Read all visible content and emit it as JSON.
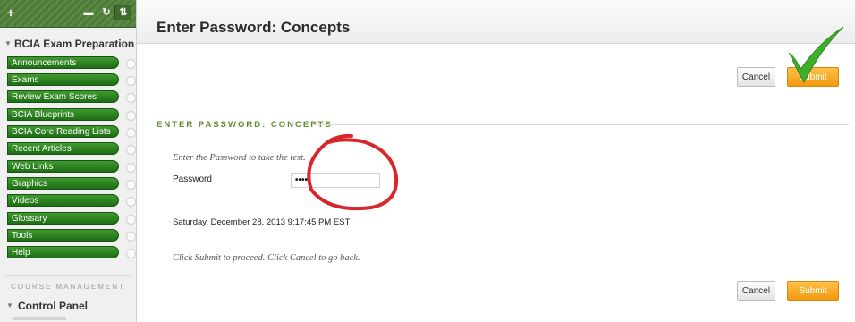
{
  "sidebar": {
    "toolbar": {
      "add_icon": "plus-icon",
      "icons": [
        "folder-icon",
        "refresh-icon",
        "sort-icon"
      ]
    },
    "course_title": "BCIA Exam Preparation",
    "menu_items": [
      {
        "label": "Announcements"
      },
      {
        "label": "Exams"
      },
      {
        "label": "Review Exam Scores"
      },
      {
        "label": "BCIA Blueprints"
      },
      {
        "label": "BCIA Core Reading Lists"
      },
      {
        "label": "Recent Articles"
      },
      {
        "label": "Web Links"
      },
      {
        "label": "Graphics"
      },
      {
        "label": "Videos"
      },
      {
        "label": "Glossary"
      },
      {
        "label": "Tools"
      },
      {
        "label": "Help"
      }
    ],
    "course_management_heading": "COURSE MANAGEMENT",
    "control_panel": "Control Panel"
  },
  "header": {
    "title": "Enter Password: Concepts"
  },
  "buttons": {
    "cancel": "Cancel",
    "submit": "Submit"
  },
  "form": {
    "section_heading": "ENTER PASSWORD: CONCEPTS",
    "instructions": "Enter the Password to take the test.",
    "password_label": "Password",
    "password_value": "•••••",
    "timestamp": "Saturday, December 28, 2013 9:17:45 PM EST",
    "bottom_note": "Click Submit to proceed. Click Cancel to go back."
  },
  "colors": {
    "menu_green": "#2e8a22",
    "submit_orange": "#f5a623",
    "annotation_red": "#d8262b",
    "checkmark_green": "#3fae2a"
  }
}
